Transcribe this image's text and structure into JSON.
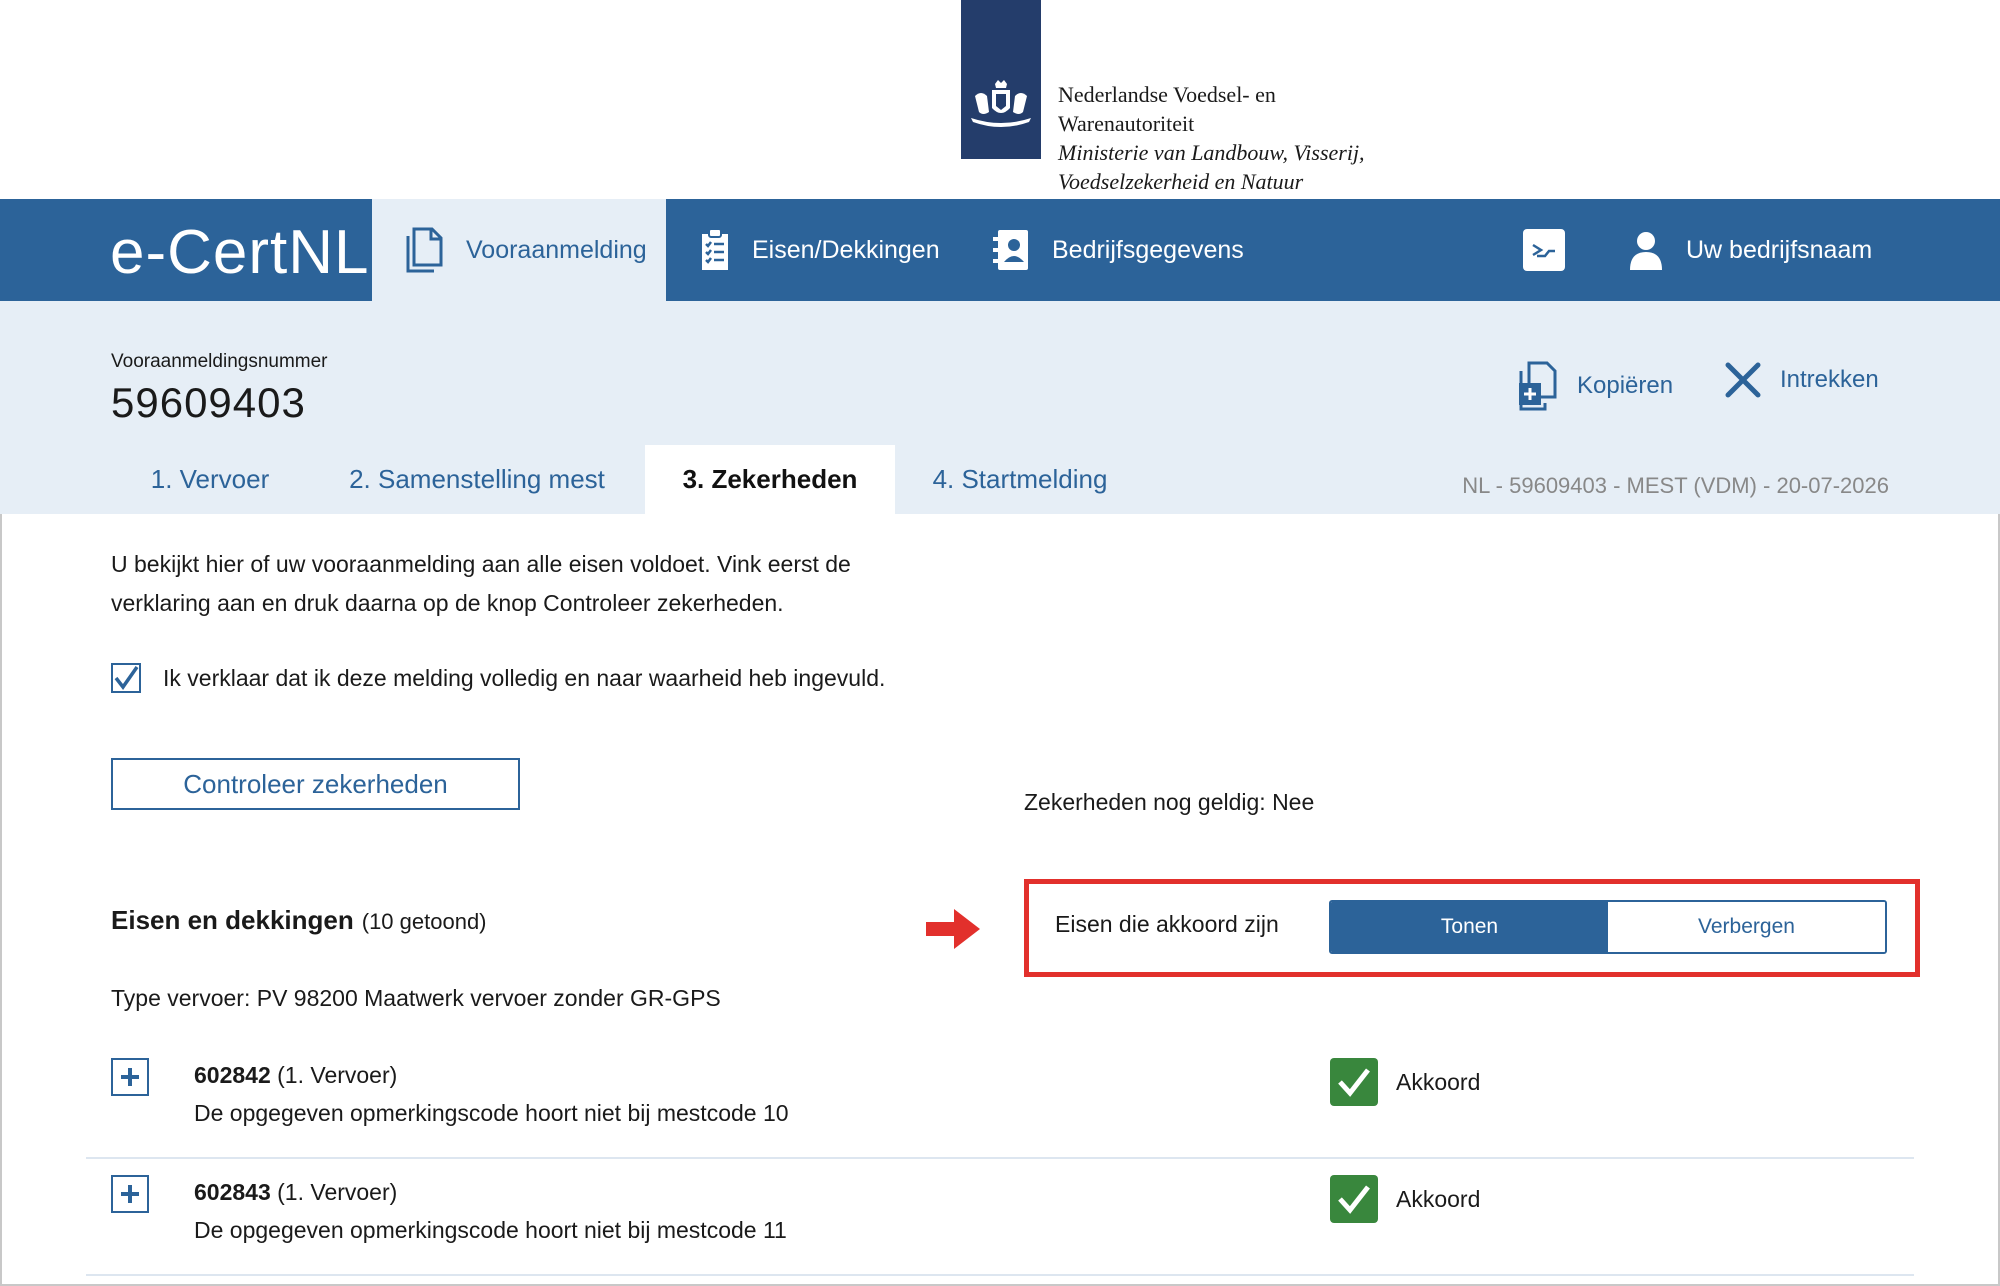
{
  "org": {
    "line1": "Nederlandse Voedsel- en",
    "line2": "Warenautoriteit",
    "line3": "Ministerie van Landbouw, Visserij,",
    "line4": "Voedselzekerheid en Natuur"
  },
  "nav": {
    "brand": "e-CertNL",
    "items": [
      {
        "label": "Vooraanmelding",
        "icon": "document-icon",
        "active": true
      },
      {
        "label": "Eisen/Dekkingen",
        "icon": "clipboard-icon",
        "active": false
      },
      {
        "label": "Bedrijfsgegevens",
        "icon": "contact-book-icon",
        "active": false
      }
    ],
    "terminal_icon": "terminal-icon",
    "user": {
      "label": "Uw bedrijfsnaam",
      "icon": "user-icon"
    }
  },
  "header": {
    "label": "Vooraanmeldingsnummer",
    "number": "59609403",
    "actions": {
      "copy": {
        "label": "Kopiëren",
        "icon": "copy-icon"
      },
      "revoke": {
        "label": "Intrekken",
        "icon": "close-icon"
      }
    },
    "reference": "NL - 59609403 - MEST (VDM) - 20-07-2026"
  },
  "tabs": [
    {
      "label": "1. Vervoer",
      "active": false
    },
    {
      "label": "2. Samenstelling mest",
      "active": false
    },
    {
      "label": "3. Zekerheden",
      "active": true
    },
    {
      "label": "4. Startmelding",
      "active": false
    }
  ],
  "content": {
    "intro": "U bekijkt hier of uw vooraanmelding aan alle eisen voldoet. Vink eerst de verklaring aan en druk daarna op de knop Controleer zekerheden.",
    "declaration": {
      "label": "Ik verklaar dat ik deze melding volledig en naar waarheid heb ingevuld.",
      "checked": true
    },
    "check_button": "Controleer zekerheden",
    "validity": "Zekerheden nog geldig: Nee",
    "section_title": "Eisen en dekkingen",
    "section_count": "(10 getoond)",
    "transport_type": "Type vervoer: PV 98200 Maatwerk vervoer zonder GR-GPS",
    "toggle": {
      "label": "Eisen die akkoord zijn",
      "options": [
        "Tonen",
        "Verbergen"
      ],
      "selected": "Tonen"
    },
    "requirements": [
      {
        "code": "602842",
        "category": "(1. Vervoer)",
        "description": "De opgegeven opmerkingscode hoort niet bij mestcode 10",
        "status": "Akkoord"
      },
      {
        "code": "602843",
        "category": "(1. Vervoer)",
        "description": "De opgegeven opmerkingscode hoort niet bij mestcode 11",
        "status": "Akkoord"
      }
    ]
  },
  "colors": {
    "primary": "#2c6399",
    "logo_bar": "#243d6b",
    "light_bg": "#e6eef6",
    "highlight": "#e2302c",
    "success": "#39873d"
  }
}
